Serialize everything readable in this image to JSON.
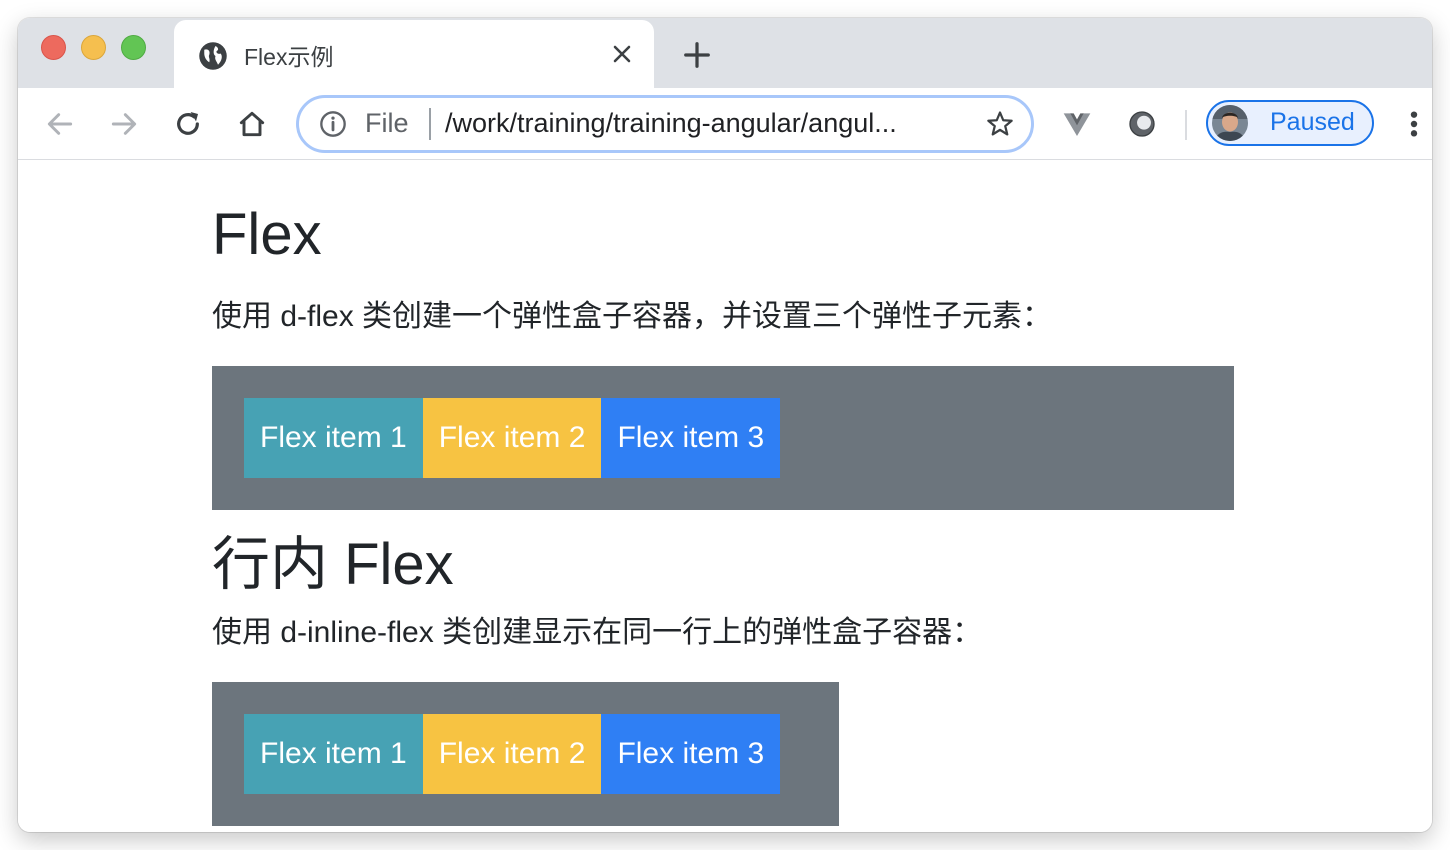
{
  "browser": {
    "tab": {
      "title": "Flex示例",
      "favicon": "globe-icon"
    },
    "toolbar": {
      "address": {
        "scheme_label": "File",
        "url": "/work/training/training-angular/angul..."
      },
      "profile": {
        "label": "Paused"
      }
    },
    "colors": {
      "tabstrip": "#dee1e6",
      "accent": "#1a73e8"
    }
  },
  "page": {
    "section1": {
      "heading": "Flex",
      "description": "使用 d-flex 类创建一个弹性盒子容器，并设置三个弹性子元素：",
      "items": [
        {
          "label": "Flex item 1",
          "color": "#47a2b4"
        },
        {
          "label": "Flex item 2",
          "color": "#f7c342"
        },
        {
          "label": "Flex item 3",
          "color": "#2f7ff4"
        }
      ]
    },
    "section2": {
      "heading": "行内 Flex",
      "description": "使用 d-inline-flex 类创建显示在同一行上的弹性盒子容器：",
      "items": [
        {
          "label": "Flex item 1",
          "color": "#47a2b4"
        },
        {
          "label": "Flex item 2",
          "color": "#f7c342"
        },
        {
          "label": "Flex item 3",
          "color": "#2f7ff4"
        }
      ]
    },
    "container_color": "#6c757d"
  }
}
